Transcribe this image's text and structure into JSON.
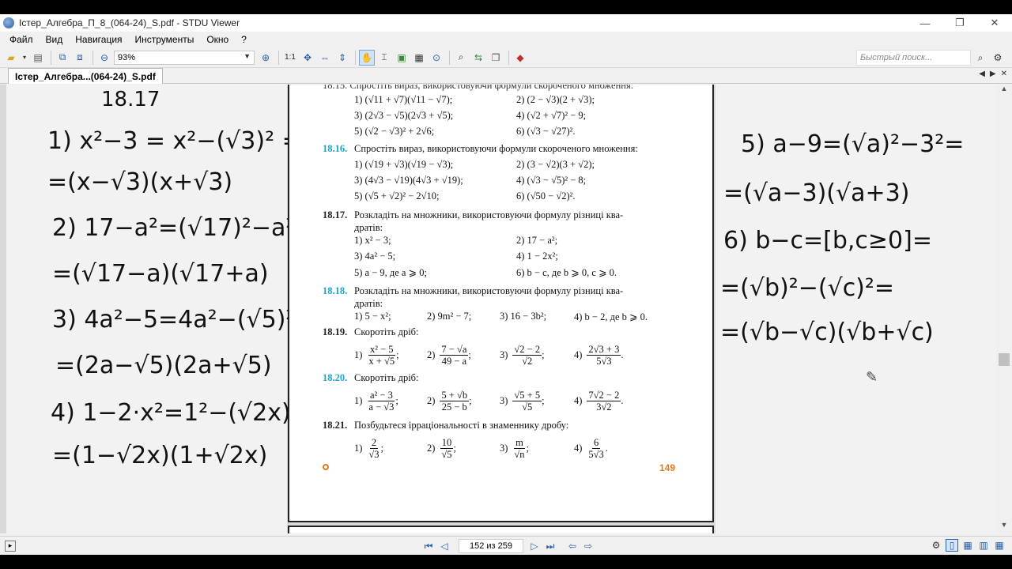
{
  "window": {
    "title": "Істер_Алгебра_П_8_(064-24)_S.pdf - STDU Viewer",
    "minimize": "—",
    "maximize": "❐",
    "close": "✕"
  },
  "menu": [
    "Файл",
    "Вид",
    "Навигация",
    "Инструменты",
    "Окно",
    "?"
  ],
  "toolbar": {
    "zoom": "93%",
    "ratio": "1:1",
    "search_placeholder": "Быстрый поиск..."
  },
  "tab": {
    "label": "Істер_Алгебра...(064-24)_S.pdf"
  },
  "left_notes": [
    "18.17",
    "1) x²−3 = x²−(√3)² =",
    "=(x−√3)(x+√3)",
    "2) 17−a²=(√17)²−a²=",
    "=(√17−a)(√17+a)",
    "3) 4a²−5=4a²−(√5)²=",
    "=(2a−√5)(2a+√5)",
    "4) 1−2·x²=1²−(√2x)²=",
    "=(1−√2x)(1+√2x)"
  ],
  "right_notes": [
    "5) a−9=(√a)²−3²=",
    "=(√a−3)(√a+3)",
    "6) b−c=[b,c≥0]=",
    "=(√b)²−(√c)²=",
    "=(√b−√c)(√b+√c)"
  ],
  "page": {
    "number": "149",
    "cut_top": "18.15. Спростіть вираз, використовуючи формули скороченого множення:",
    "problems": {
      "p1615": {
        "items": [
          "1) (√11 + √7)(√11 − √7);",
          "2) (2 − √3)(2 + √3);",
          "3) (2√3 − √5)(2√3 + √5);",
          "4) (√2 + √7)² − 9;",
          "5) (√2 − √3)² + 2√6;",
          "6) (√3 − √27)²."
        ]
      },
      "p1616": {
        "num": "18.16.",
        "text": "Спростіть вираз, використовуючи формули скороченого множення:",
        "items": [
          "1) (√19 + √3)(√19 − √3);",
          "2) (3 − √2)(3 + √2);",
          "3) (4√3 − √19)(4√3 + √19);",
          "4) (√3 − √5)² − 8;",
          "5) (√5 + √2)² − 2√10;",
          "6) (√50 − √2)²."
        ]
      },
      "p1617": {
        "num": "18.17.",
        "text1": "Розкладіть на множники, використовуючи формулу різниці ква-",
        "text2": "дратів:",
        "items": [
          "1) x² − 3;",
          "2) 17 − a²;",
          "3) 4a² − 5;",
          "4) 1 − 2x²;",
          "5) a − 9, де a ⩾ 0;",
          "6) b − c, де b ⩾ 0, c ⩾ 0."
        ]
      },
      "p1618": {
        "num": "18.18.",
        "text1": "Розкладіть на множники, використовуючи формулу різниці ква-",
        "text2": "дратів:",
        "items": [
          "1) 5 − x²;",
          "2) 9m² − 7;",
          "3) 16 − 3b²;",
          "4) b − 2, де b ⩾ 0."
        ]
      },
      "p1619": {
        "num": "18.19.",
        "text": "Скоротіть дріб:",
        "items": [
          {
            "n": "1)",
            "top": "x² − 5",
            "bot": "x + √5",
            "end": ";"
          },
          {
            "n": "2)",
            "top": "7 − √a",
            "bot": "49 − a",
            "end": ";"
          },
          {
            "n": "3)",
            "top": "√2 − 2",
            "bot": "√2",
            "end": ";"
          },
          {
            "n": "4)",
            "top": "2√3 + 3",
            "bot": "5√3",
            "end": "."
          }
        ]
      },
      "p1620": {
        "num": "18.20.",
        "text": "Скоротіть дріб:",
        "items": [
          {
            "n": "1)",
            "top": "a² − 3",
            "bot": "a − √3",
            "end": ";"
          },
          {
            "n": "2)",
            "top": "5 + √b",
            "bot": "25 − b",
            "end": ";"
          },
          {
            "n": "3)",
            "top": "√5 + 5",
            "bot": "√5",
            "end": ";"
          },
          {
            "n": "4)",
            "top": "7√2 − 2",
            "bot": "3√2",
            "end": "."
          }
        ]
      },
      "p1621": {
        "num": "18.21.",
        "text": "Позбудьтеся ірраціональності в знаменнику дробу:",
        "items": [
          {
            "n": "1)",
            "top": "2",
            "bot": "√3",
            "end": ";"
          },
          {
            "n": "2)",
            "top": "10",
            "bot": "√5",
            "end": ";"
          },
          {
            "n": "3)",
            "top": "m",
            "bot": "√n",
            "end": ";"
          },
          {
            "n": "4)",
            "top": "6",
            "bot": "5√3",
            "end": "."
          }
        ]
      }
    }
  },
  "status": {
    "page_indicator": "152 из 259"
  },
  "colors": {
    "problem_number_cyan": "#1aa5c8",
    "page_number_orange": "#e07a20",
    "accent_blue": "#2a5ea8"
  }
}
